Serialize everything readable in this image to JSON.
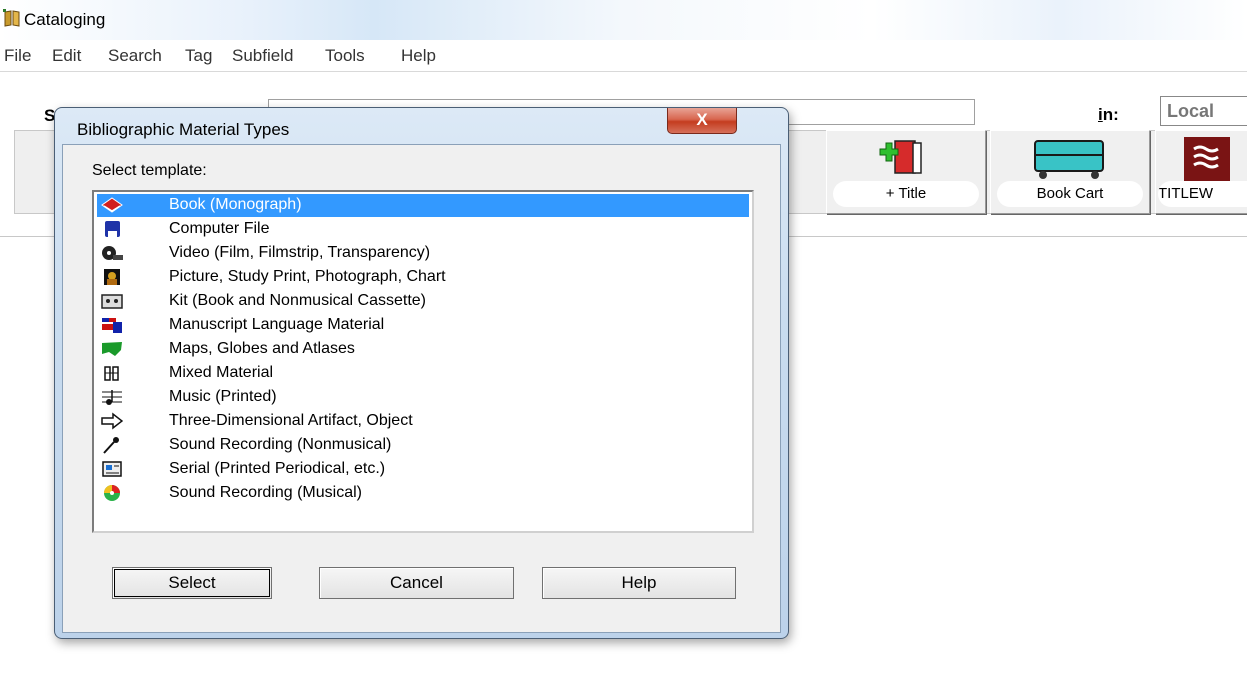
{
  "window": {
    "title": "Cataloging",
    "icon": "cataloging-app-icon"
  },
  "menu": [
    "File",
    "Edit",
    "Search",
    "Tag",
    "Subfield",
    "Tools",
    "Help"
  ],
  "search": {
    "label": "S",
    "value": "",
    "in_label": "in:",
    "scope": "Local"
  },
  "toolbar": [
    {
      "label": "+ Title",
      "icon": "add-title-icon"
    },
    {
      "label": "Book Cart",
      "icon": "book-cart-icon"
    },
    {
      "label": "TITLEW",
      "icon": "titlewave-icon"
    }
  ],
  "dialog": {
    "title": "Bibliographic Material Types",
    "close_label": "X",
    "prompt": "Select template:",
    "items": [
      {
        "label": "Book (Monograph)",
        "icon": "book-icon",
        "selected": true
      },
      {
        "label": "Computer File",
        "icon": "floppy-disk-icon"
      },
      {
        "label": "Video (Film, Filmstrip, Transparency)",
        "icon": "film-reel-icon"
      },
      {
        "label": "Picture, Study Print, Photograph, Chart",
        "icon": "picture-icon"
      },
      {
        "label": "Kit (Book and Nonmusical Cassette)",
        "icon": "cassette-icon"
      },
      {
        "label": "Manuscript Language Material",
        "icon": "flag-manuscript-icon"
      },
      {
        "label": "Maps, Globes and Atlases",
        "icon": "map-icon"
      },
      {
        "label": "Mixed Material",
        "icon": "mixed-material-icon"
      },
      {
        "label": "Music (Printed)",
        "icon": "music-note-icon"
      },
      {
        "label": "Three-Dimensional Artifact, Object",
        "icon": "arrow-object-icon"
      },
      {
        "label": "Sound Recording (Nonmusical)",
        "icon": "microphone-icon"
      },
      {
        "label": "Serial (Printed Periodical, etc.)",
        "icon": "newspaper-icon"
      },
      {
        "label": "Sound Recording (Musical)",
        "icon": "cd-icon"
      }
    ],
    "buttons": {
      "select": "Select",
      "cancel": "Cancel",
      "help": "Help"
    }
  }
}
